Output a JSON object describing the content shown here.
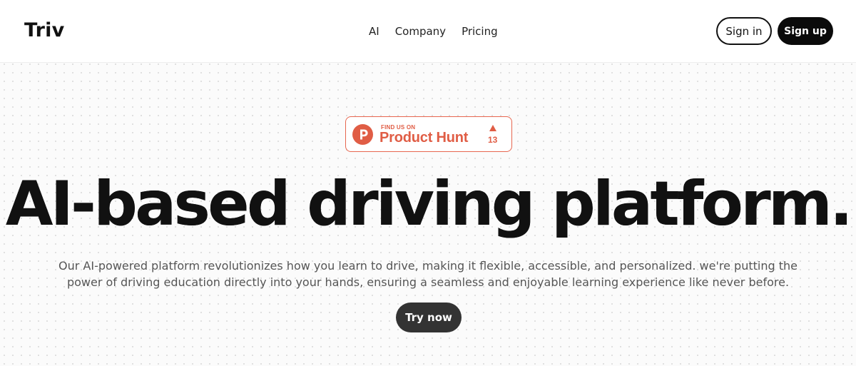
{
  "header": {
    "logo": "Triv",
    "nav": [
      {
        "label": "AI"
      },
      {
        "label": "Company"
      },
      {
        "label": "Pricing"
      }
    ],
    "sign_in_label": "Sign in",
    "sign_up_label": "Sign up"
  },
  "badge": {
    "icon": "product-hunt-p-icon",
    "letter": "P",
    "small_text": "FIND US ON",
    "name": "Product Hunt",
    "upvote_icon": "triangle-up-icon",
    "count": "13",
    "accent_color": "#e05d45"
  },
  "hero": {
    "title": "AI-based driving platform.",
    "subtitle": "Our AI-powered platform revolutionizes how you learn to drive, making it flexible, accessible, and personalized. we're putting the power of driving education directly into your hands, ensuring a seamless and enjoyable learning experience like never before.",
    "cta_label": "Try now"
  },
  "colors": {
    "primary": "#0b0b0b",
    "cta_background": "#333333",
    "text_muted": "#555555",
    "page_background": "#fbfbfb"
  }
}
